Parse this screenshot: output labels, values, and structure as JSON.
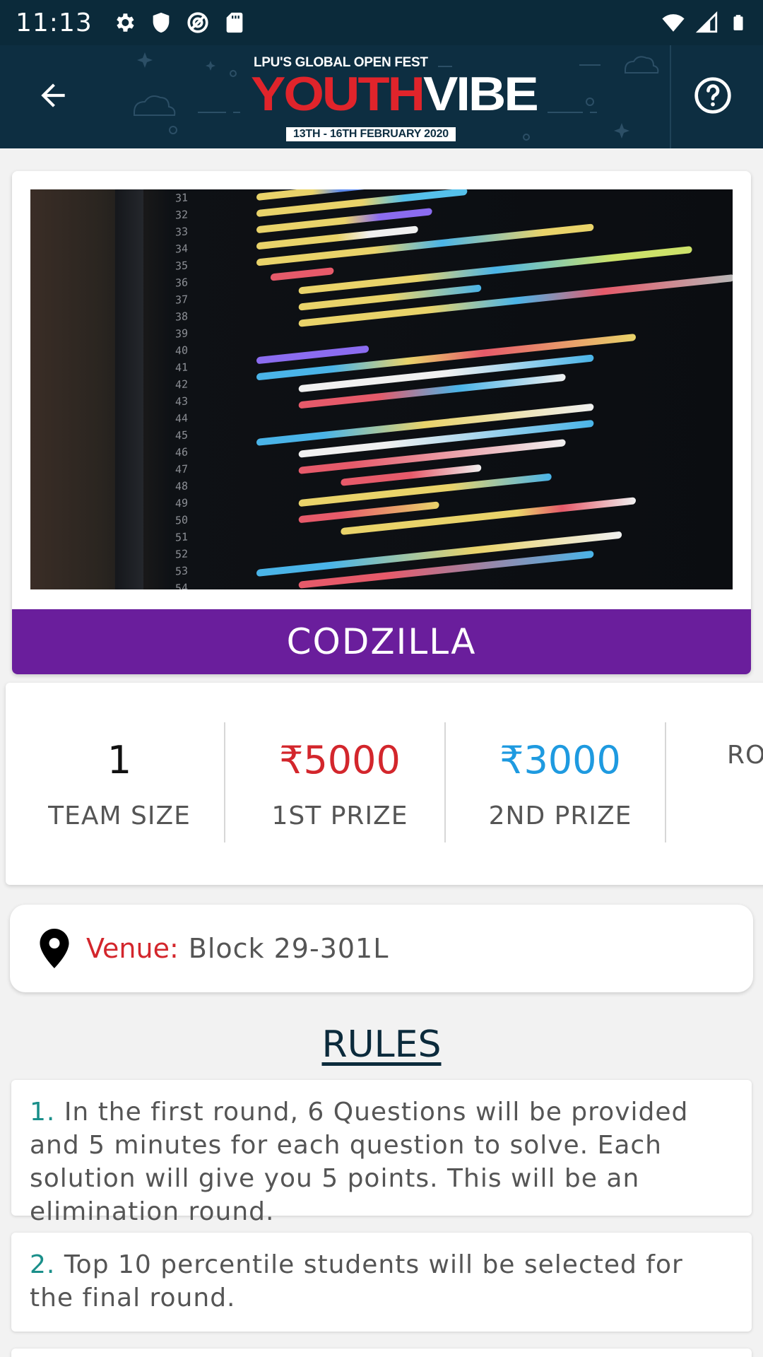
{
  "status_bar": {
    "time": "11:13",
    "left_icons": [
      "gear-icon",
      "shield-icon",
      "vpn-icon",
      "sd-card-icon"
    ],
    "right_icons": [
      "wifi-icon",
      "signal-icon",
      "battery-icon"
    ]
  },
  "app_bar": {
    "back_icon": "arrow-back-icon",
    "help_icon": "help-circle-icon",
    "logo": {
      "top_text": "LPU'S GLOBAL OPEN FEST",
      "main_red": "YOUTH",
      "main_white": "VIBE",
      "dates": "13TH - 16TH FEBRUARY 2020"
    }
  },
  "event": {
    "title": "CODZILLA",
    "image_icon": "code-screen-photo"
  },
  "stats": [
    {
      "value": "1",
      "label": "TEAM SIZE",
      "color": "#111111"
    },
    {
      "value": "₹5000",
      "label": "1ST PRIZE",
      "color": "#d3262c"
    },
    {
      "value": "₹3000",
      "label": "2ND PRIZE",
      "color": "#1e9ae0"
    },
    {
      "value": "",
      "label": "RO",
      "color": "#555555"
    }
  ],
  "venue": {
    "icon": "location-pin-icon",
    "label": "Venue:",
    "value": "Block 29-301L"
  },
  "rules": {
    "heading": "RULES",
    "items": [
      {
        "num": "1.",
        "text": "In the first round, 6 Questions will be provided and 5 minutes for each question to solve. Each solution will give you 5 points. This will be an elimination round."
      },
      {
        "num": "2.",
        "text": "Top 10 percentile students will be selected for the final round."
      }
    ]
  },
  "colors": {
    "header_bg": "#0d2e41",
    "title_bar": "#6a1e9c",
    "prize_first": "#d3262c",
    "prize_second": "#1e9ae0",
    "venue_label": "#d3262c",
    "rule_number": "#1a8f8a"
  }
}
